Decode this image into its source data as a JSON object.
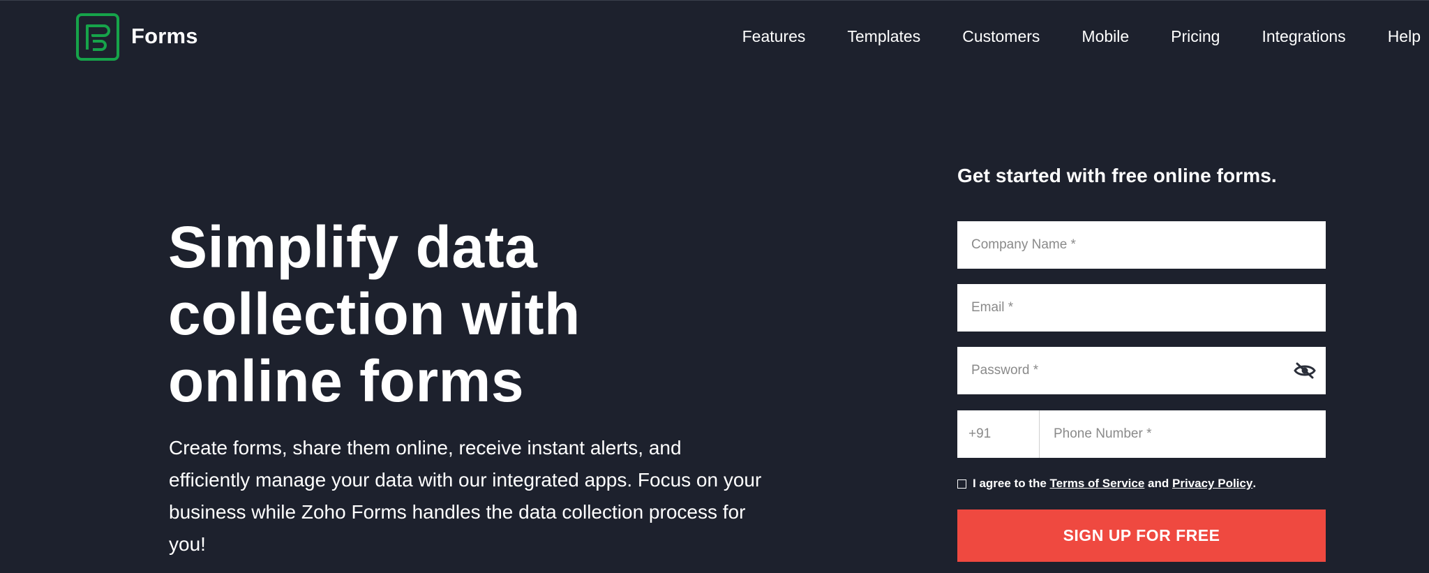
{
  "header": {
    "brand": "Forms",
    "nav": [
      "Features",
      "Templates",
      "Customers",
      "Mobile",
      "Pricing",
      "Integrations",
      "Help"
    ]
  },
  "hero": {
    "title_lines": [
      "Simplify data",
      "collection with",
      "online forms"
    ],
    "description": "Create forms, share them online, receive instant alerts, and efficiently manage your data with our integrated apps. Focus on your business while Zoho Forms handles the data collection process for you!"
  },
  "signup": {
    "title": "Get started with free online forms.",
    "company_placeholder": "Company Name *",
    "email_placeholder": "Email *",
    "password_placeholder": "Password *",
    "country_code": "+91",
    "phone_placeholder": "Phone Number *",
    "agree_prefix": "I agree to the",
    "terms_link": "Terms of Service",
    "agree_and": "and",
    "privacy_link": "Privacy Policy",
    "agree_suffix": ".",
    "cta_label": "SIGN UP FOR FREE"
  },
  "colors": {
    "background": "#1d212d",
    "cta": "#ef4940",
    "logo_green": "#16a34a"
  },
  "icons": [
    "forms-logo-icon",
    "eye-slash-icon",
    "checkbox-icon"
  ]
}
